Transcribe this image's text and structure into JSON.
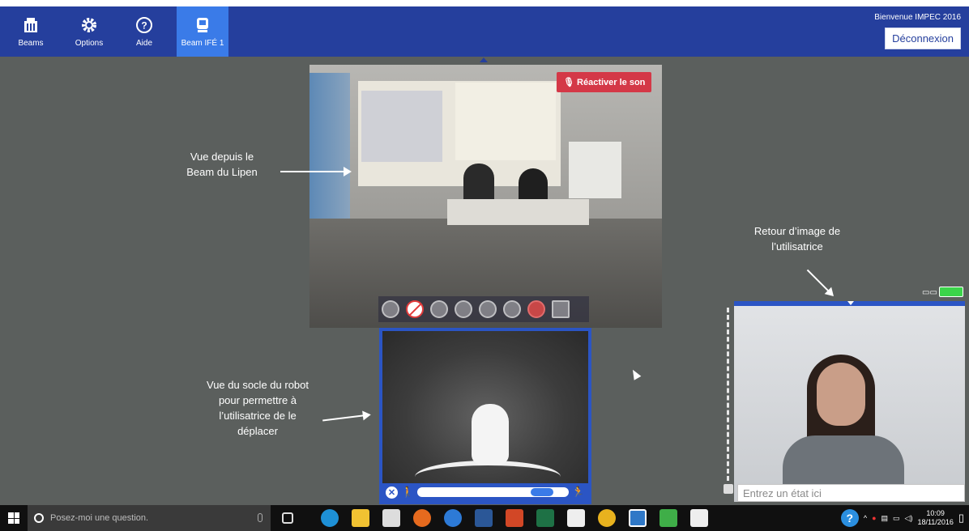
{
  "app": {
    "welcome": "Bienvenue IMPEC 2016",
    "logout_label": "Déconnexion"
  },
  "nav": [
    {
      "label": "Beams",
      "icon": "building-icon"
    },
    {
      "label": "Options",
      "icon": "gear-icon"
    },
    {
      "label": "Aide",
      "icon": "help-icon"
    },
    {
      "label": "Beam IFÉ 1",
      "icon": "robot-icon",
      "active": true
    }
  ],
  "main_video": {
    "reactivate_label": "Réactiver le son"
  },
  "self_view": {
    "status_placeholder": "Entrez un état ici"
  },
  "annotations": {
    "main": "Vue depuis le Beam du Lipen",
    "floor": "Vue du socle du robot pour permettre à l’utilisatrice de le déplacer",
    "self": "Retour d’image de l’utilisatrice"
  },
  "taskbar": {
    "search_placeholder": "Posez-moi une question.",
    "time": "10:09",
    "date": "18/11/2016"
  },
  "colors": {
    "topbar": "#253f9d",
    "active_tab": "#3a7be8",
    "reactivate": "#d43847",
    "battery": "#3bd44a"
  }
}
